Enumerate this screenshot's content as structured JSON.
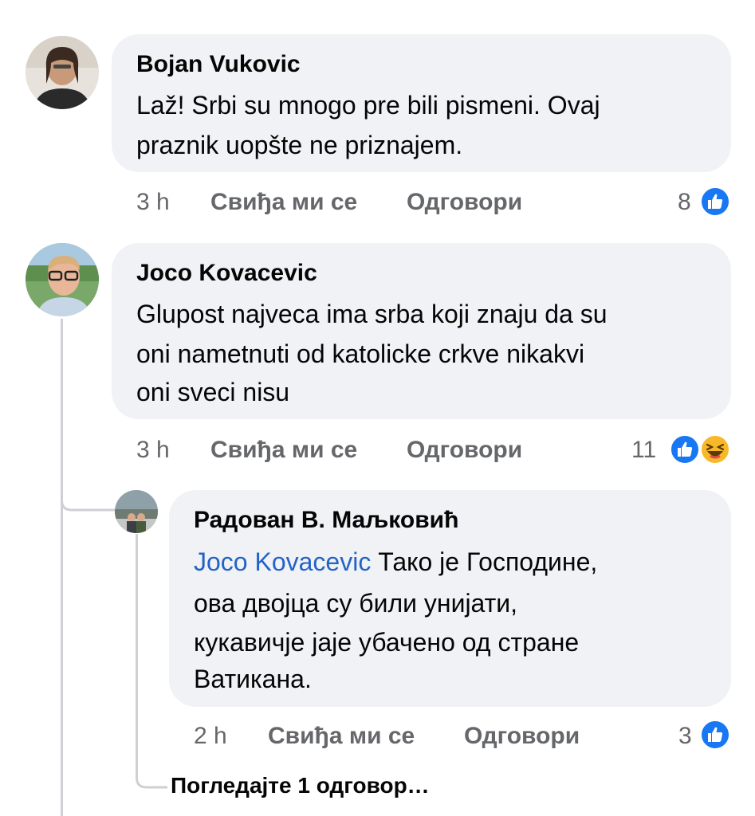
{
  "comments": [
    {
      "author": "Bojan Vukovic",
      "lines": [
        "Laž! Srbi su mnogo pre bili pismeni. Ovaj",
        "praznik uopšte ne priznajem."
      ],
      "time": "3 h",
      "like_label": "Свиђа ми се",
      "reply_label": "Одговори",
      "reaction_count": "8",
      "reactions": [
        "like-icon"
      ]
    },
    {
      "author": "Joco Kovacevic",
      "lines": [
        "Glupost najveca ima srba koji znaju da su",
        "oni nametnuti od katolicke crkve nikakvi",
        "oni sveci nisu"
      ],
      "time": "3 h",
      "like_label": "Свиђа ми се",
      "reply_label": "Одговори",
      "reaction_count": "11",
      "reactions": [
        "like-icon",
        "haha-icon"
      ]
    }
  ],
  "reply": {
    "author": "Радован В. Маљковић",
    "mention": "Joco Kovacevic",
    "first_line_rest": " Тако је Господине,",
    "lines": [
      "ова двојца су били унијати,",
      "кукавичје јаје убачено од стране",
      "Ватикана."
    ],
    "time": "2 h",
    "like_label": "Свиђа ми се",
    "reply_label": "Одговори",
    "reaction_count": "3",
    "reactions": [
      "like-icon"
    ]
  },
  "view_more_replies": "Погледајте 1 одговор…",
  "colors": {
    "bubble": "#f0f2f5",
    "like_blue": "#1877f2",
    "haha_yellow": "#f7b928",
    "mention": "#2463c6",
    "meta_gray": "#65676b"
  }
}
